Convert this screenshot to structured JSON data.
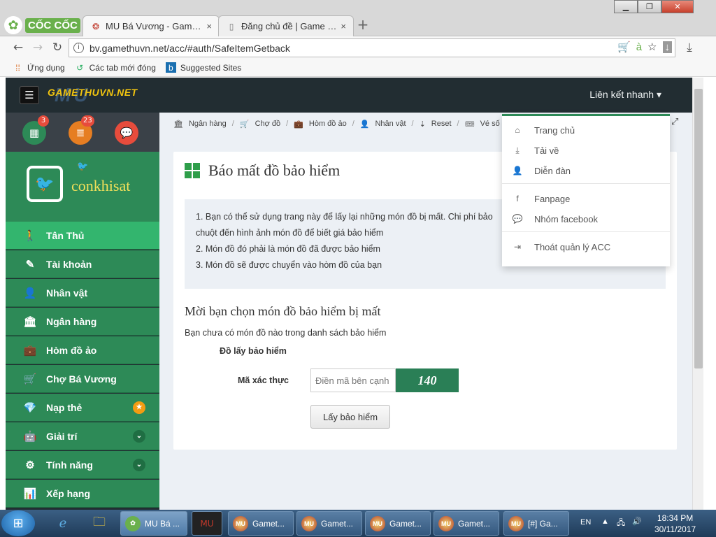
{
  "browser": {
    "brand": "CỐC CỐC",
    "tabs": [
      {
        "label": "MU Bá Vương - GamethuVN",
        "close": "×"
      },
      {
        "label": "Đăng chủ đề | Game thủ VN",
        "close": "×"
      }
    ],
    "new_tab": "+",
    "window_buttons": {
      "minimize": "▁",
      "maximize": "❐",
      "close": "✕"
    },
    "url": "bv.gamethuvn.net/acc/#auth/SafeItemGetback",
    "bookmarks": [
      "Ứng dụng",
      "Các tab mới đóng",
      "Suggested Sites"
    ]
  },
  "site": {
    "logo": "GAMETHUVN.NET",
    "logo_mu": "MU",
    "quick_links_label": "Liên kết nhanh ▾",
    "sidebar_badges": {
      "calendar": "3",
      "list": "23"
    },
    "username": "conkhisat",
    "menu": [
      {
        "label": "Tân Thủ",
        "icon": "🚶"
      },
      {
        "label": "Tài khoản",
        "icon": "✎"
      },
      {
        "label": "Nhân vật",
        "icon": "👤"
      },
      {
        "label": "Ngân hàng",
        "icon": "🏛"
      },
      {
        "label": "Hòm đồ ảo",
        "icon": "💼"
      },
      {
        "label": "Chợ Bá Vương",
        "icon": "🛒"
      },
      {
        "label": "Nạp thẻ",
        "icon": "💎",
        "badge": "★"
      },
      {
        "label": "Giải trí",
        "icon": "🤖",
        "badge": "⌄"
      },
      {
        "label": "Tính năng",
        "icon": "⚙",
        "badge": "⌄"
      },
      {
        "label": "Xếp hạng",
        "icon": "📊"
      }
    ],
    "breadcrumbs": [
      "Ngân hàng",
      "Chợ đồ",
      "Hòm đồ ảo",
      "Nhân vật",
      "Reset",
      "Vé số"
    ],
    "dropdown": [
      "Trang chủ",
      "Tải về",
      "Diễn đàn",
      "Fanpage",
      "Nhóm facebook",
      "Thoát quản lý ACC"
    ]
  },
  "content": {
    "title": "Báo mất đồ bảo hiểm",
    "info_lines": [
      "1. Bạn có thể sử dụng trang này để lấy lại những món đồ bị mất. Chi phí bảo",
      "chuột đến hình ảnh món đồ để biết giá bảo hiểm",
      "2. Món đồ đó phải là món đồ đã được bảo hiểm",
      "3. Món đồ sẽ được chuyển vào hòm đồ của bạn"
    ],
    "subheading": "Mời bạn chọn món đồ bảo hiểm bị mất",
    "no_items": "Bạn chưa có món đồ nào trong danh sách bảo hiểm",
    "item_label": "Đồ lấy bảo hiểm",
    "code_label": "Mã xác thực",
    "code_placeholder": "Điền mã bên cạnh",
    "captcha_text": "140",
    "submit_label": "Lấy bảo hiểm"
  },
  "taskbar": {
    "tasks": [
      "MU Bá ...",
      "Gamet...",
      "Gamet...",
      "Gamet...",
      "Gamet...",
      "[#] Ga..."
    ],
    "lang": "EN",
    "time": "18:34 PM",
    "date": "30/11/2017"
  }
}
